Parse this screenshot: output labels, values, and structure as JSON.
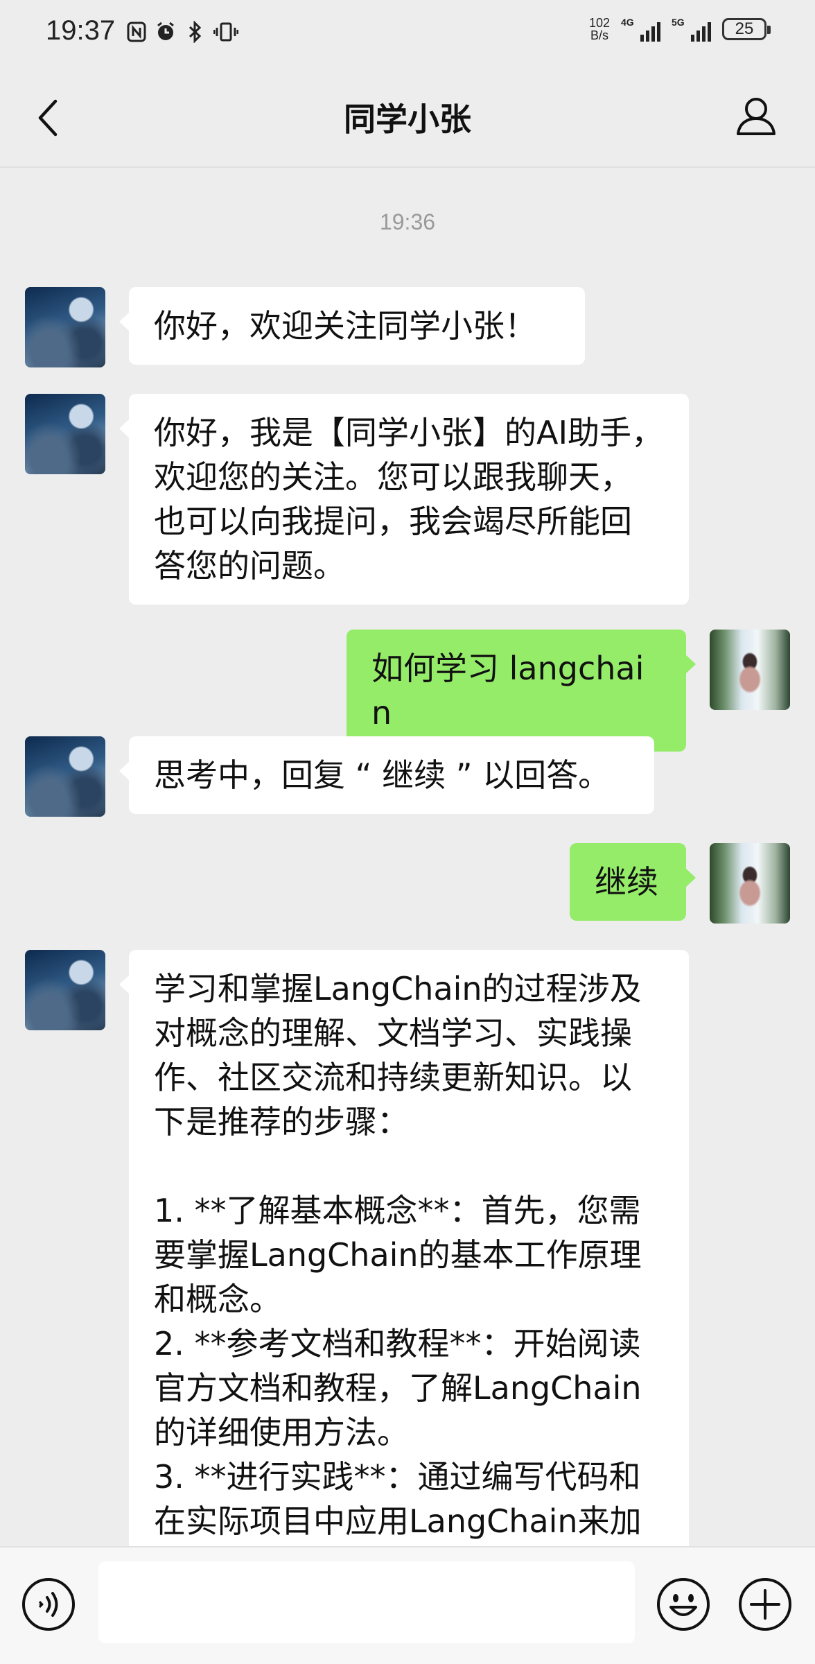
{
  "status_bar": {
    "time": "19:37",
    "net_speed_value": "102",
    "net_speed_unit": "B/s",
    "signal_1_label": "4G",
    "signal_2_label": "5G",
    "battery": "25"
  },
  "header": {
    "title": "同学小张"
  },
  "chat": {
    "timestamp": "19:36",
    "messages": [
      {
        "side": "left",
        "sender": "bot",
        "text": "你好，欢迎关注同学小张！"
      },
      {
        "side": "left",
        "sender": "bot",
        "text": "你好，我是【同学小张】的AI助手，\n欢迎您的关注。您可以跟我聊天，\n也可以向我提问，我会竭尽所能回\n答您的问题。"
      },
      {
        "side": "right",
        "sender": "user",
        "text": "如何学习 langchain"
      },
      {
        "side": "left",
        "sender": "bot",
        "text": "思考中，回复 “ 继续 ” 以回答。"
      },
      {
        "side": "right",
        "sender": "user",
        "text": "继续"
      },
      {
        "side": "left",
        "sender": "bot",
        "text": "学习和掌握LangChain的过程涉及\n对概念的理解、文档学习、实践操\n作、社区交流和持续更新知识。以\n下是推荐的步骤：\n\n1. **了解基本概念**：首先，您需\n要掌握LangChain的基本工作原理\n和概念。\n2. **参考文档和教程**：开始阅读\n官方文档和教程，了解LangChain\n的详细使用方法。\n3. **进行实践**：通过编写代码和\n在实际项目中应用LangChain来加"
      }
    ]
  },
  "input_bar": {
    "placeholder": ""
  },
  "icons": {
    "back": "chevron-left-icon",
    "profile": "person-icon",
    "voice": "voice-icon",
    "emoji": "emoji-icon",
    "plus": "plus-icon"
  },
  "colors": {
    "background": "#ededed",
    "bubble_left": "#ffffff",
    "bubble_right": "#95ec69",
    "timestamp": "#9a9a9a"
  }
}
